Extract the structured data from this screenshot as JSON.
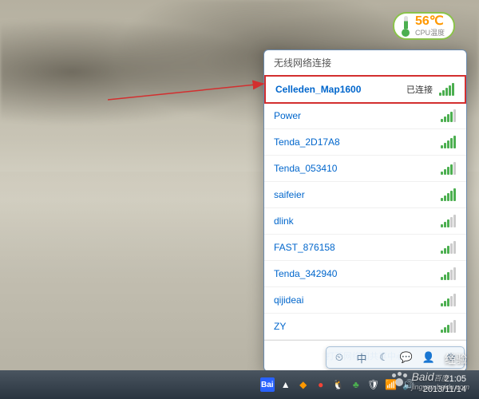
{
  "cpu": {
    "temp": "56℃",
    "label": "CPU温度"
  },
  "wifi": {
    "header": "无线网络连接",
    "connected_status": "已连接",
    "footer_link": "打开网络和共享中心",
    "networks": [
      {
        "name": "Celleden_Map1600",
        "connected": true,
        "signal": 5
      },
      {
        "name": "Power",
        "connected": false,
        "signal": 4
      },
      {
        "name": "Tenda_2D17A8",
        "connected": false,
        "signal": 5
      },
      {
        "name": "Tenda_053410",
        "connected": false,
        "signal": 4
      },
      {
        "name": "saifeier",
        "connected": false,
        "signal": 5
      },
      {
        "name": "dlink",
        "connected": false,
        "signal": 3
      },
      {
        "name": "FAST_876158",
        "connected": false,
        "signal": 3
      },
      {
        "name": "Tenda_342940",
        "connected": false,
        "signal": 3
      },
      {
        "name": "qijideai",
        "connected": false,
        "signal": 3
      },
      {
        "name": "ZY",
        "connected": false,
        "signal": 3
      }
    ]
  },
  "toolbar": {
    "items": [
      {
        "icon": "clock-icon",
        "glyph": "⏲"
      },
      {
        "icon": "zhong-icon",
        "glyph": "中"
      },
      {
        "icon": "moon-icon",
        "glyph": "☾"
      },
      {
        "icon": "bubble-icon",
        "glyph": "💬"
      },
      {
        "icon": "person-icon",
        "glyph": "👤"
      },
      {
        "icon": "gear-icon",
        "glyph": "⚙"
      }
    ]
  },
  "clock": {
    "time": "21:05",
    "date": "2013/11/14"
  },
  "watermark": {
    "brand": "Baid",
    "sub": "百度",
    "suffix": "经验",
    "url": "jingyan.baidu.com"
  }
}
